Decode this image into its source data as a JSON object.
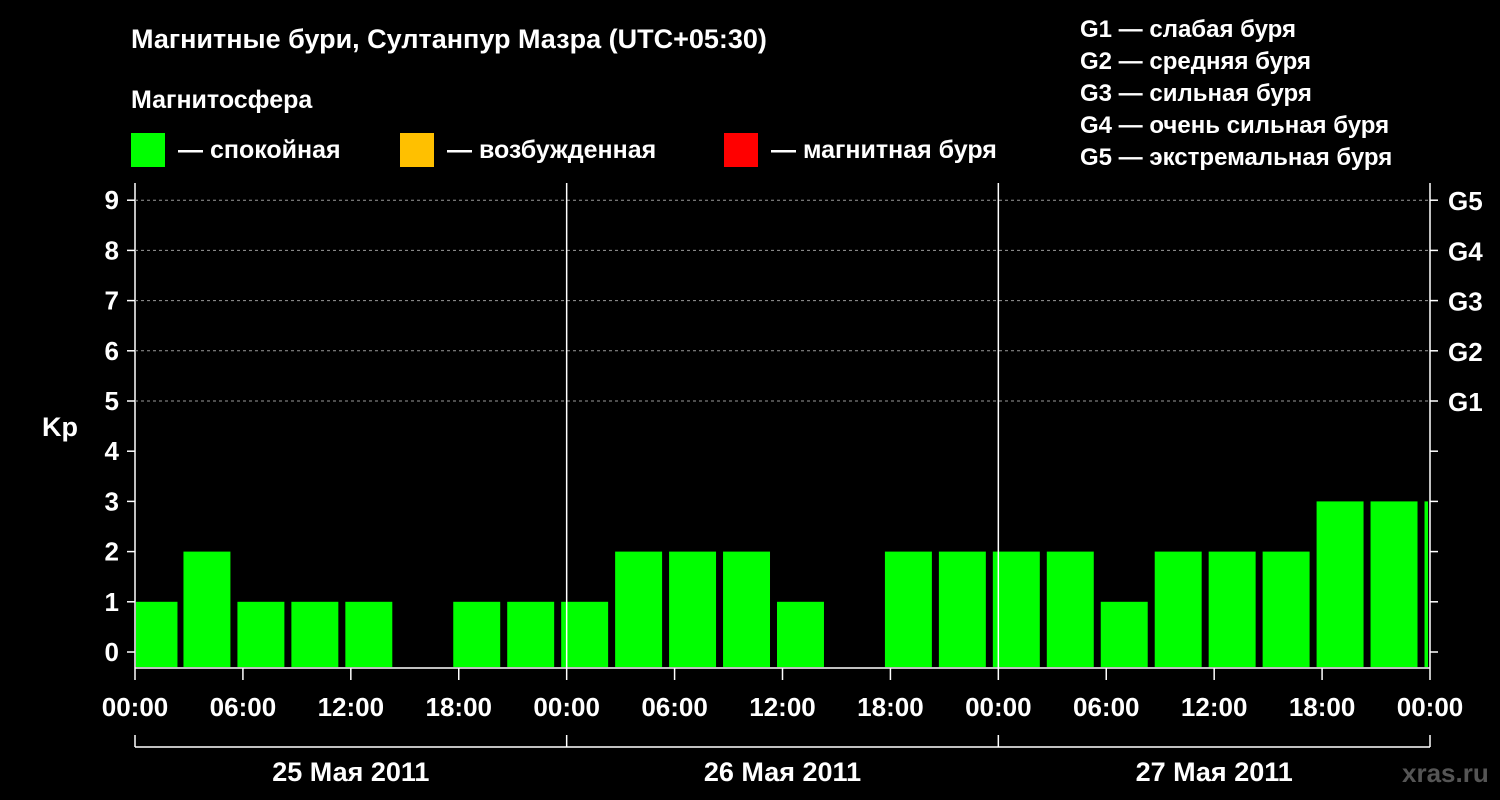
{
  "chart_data": {
    "type": "bar",
    "title": "Магнитные бури, Султанпур Мазра (UTC+05:30)",
    "subtitle": "Магнитосфера",
    "ylabel": "Kp",
    "ylim": [
      0,
      9
    ],
    "yticks": [
      "0",
      "1",
      "2",
      "3",
      "4",
      "5",
      "6",
      "7",
      "8",
      "9"
    ],
    "right_ticks": [
      {
        "kp": 5,
        "label": "G1"
      },
      {
        "kp": 6,
        "label": "G2"
      },
      {
        "kp": 7,
        "label": "G3"
      },
      {
        "kp": 8,
        "label": "G4"
      },
      {
        "kp": 9,
        "label": "G5"
      }
    ],
    "xticks": [
      "00:00",
      "06:00",
      "12:00",
      "18:00",
      "00:00",
      "06:00",
      "12:00",
      "18:00",
      "00:00",
      "06:00",
      "12:00",
      "18:00",
      "00:00"
    ],
    "days": [
      "25 Мая 2011",
      "26 Мая 2011",
      "27 Мая 2011"
    ],
    "interval_hours": 3,
    "first_interval_start_hour": 2.5,
    "first_partial": {
      "start_hour": 0,
      "end_hour": 2.5,
      "kp": 1
    },
    "values": [
      2,
      1,
      1,
      1,
      0,
      1,
      1,
      1,
      2,
      2,
      2,
      1,
      0,
      2,
      2,
      2,
      2,
      1,
      2,
      2,
      2,
      3,
      3,
      3
    ],
    "grid": true,
    "legend": [
      {
        "label": "— спокойная",
        "color": "#00ff00"
      },
      {
        "label": "— возбужденная",
        "color": "#ffc000"
      },
      {
        "label": "— магнитная буря",
        "color": "#ff0000"
      }
    ],
    "g_legend": [
      "G1 — слабая буря",
      "G2 — средняя буря",
      "G3 — сильная буря",
      "G4 — очень сильная буря",
      "G5 — экстремальная буря"
    ]
  },
  "watermark": "xras.ru"
}
